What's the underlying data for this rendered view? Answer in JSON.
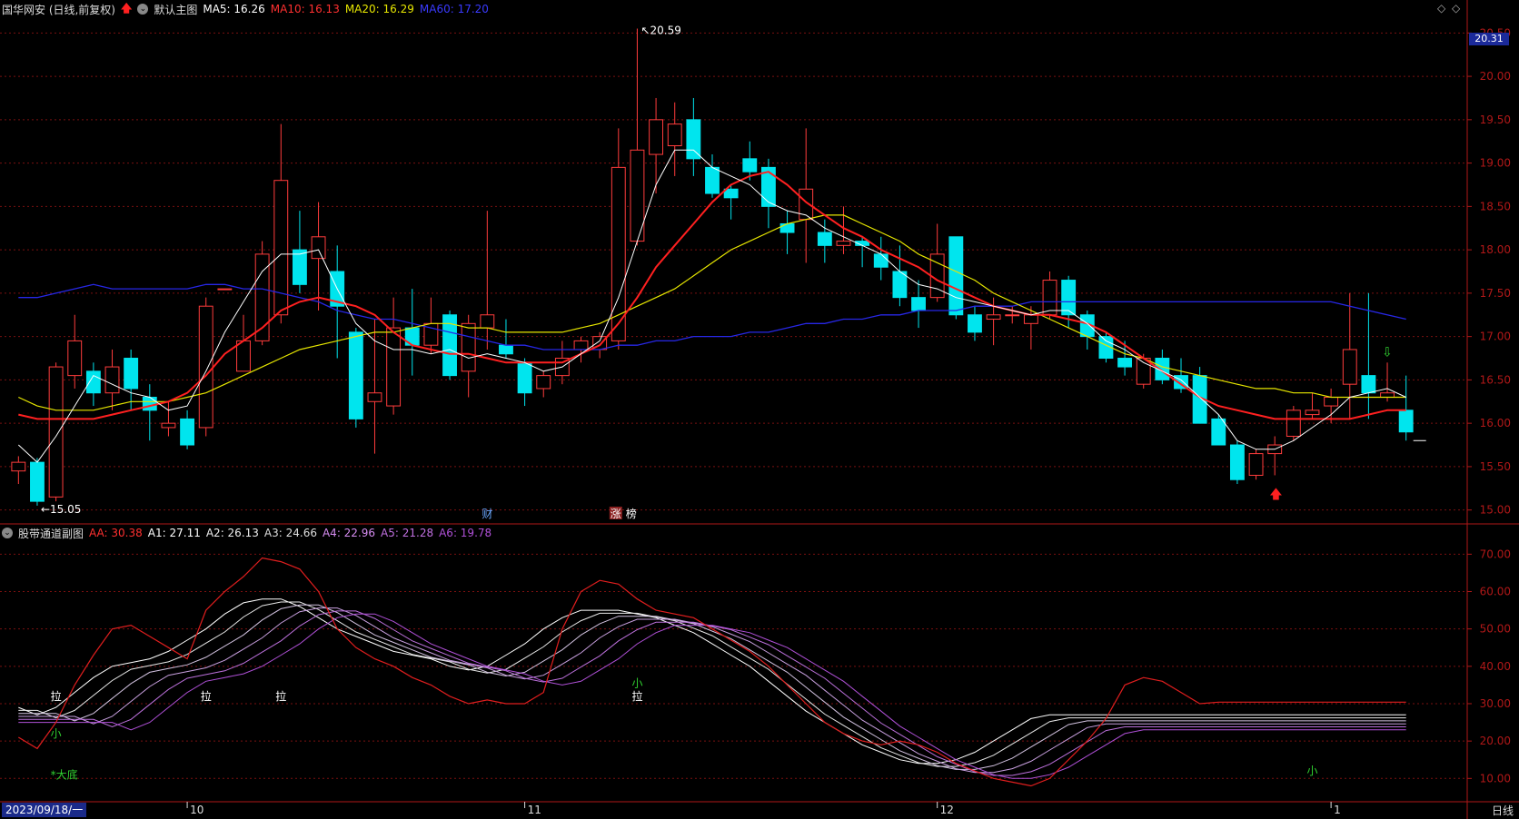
{
  "main_header": {
    "stock": "国华网安 (日线,前复权)",
    "chart_label": "默认主图",
    "ma5": "MA5: 16.26",
    "ma10": "MA10: 16.13",
    "ma20": "MA20: 16.29",
    "ma60": "MA60: 17.20"
  },
  "sub_header": {
    "indicator": "股带通道副图",
    "aa": "AA: 30.38",
    "a1": "A1: 27.11",
    "a2": "A2: 26.13",
    "a3": "A3: 24.66",
    "a4": "A4: 22.96",
    "a5": "A5: 21.28",
    "a6": "A6: 19.78"
  },
  "colors": {
    "bg": "#000000",
    "up": "#ff3c3c",
    "down": "#00e5ee",
    "ma5": "#ffffff",
    "ma10": "#ff2020",
    "ma20": "#e6e600",
    "ma60": "#2727e6",
    "grid": "#7a1010",
    "axis": "#b01818",
    "band_light": "#ffffff",
    "band_dark": "#b43cd2"
  },
  "price_axis": {
    "ticks": [
      "20.50",
      "20.00",
      "19.50",
      "19.00",
      "18.50",
      "18.00",
      "17.50",
      "17.00",
      "16.50",
      "16.00",
      "15.50",
      "15.00"
    ],
    "current": "20.31"
  },
  "sub_axis": {
    "ticks": [
      "70.00",
      "60.00",
      "50.00",
      "40.00",
      "30.00",
      "20.00",
      "10.00"
    ]
  },
  "time_axis": {
    "start": "2023/09/18/一",
    "months": [
      "10",
      "11",
      "12",
      "1"
    ],
    "period": "日线"
  },
  "annotations": {
    "high": "20.59",
    "low": "15.05",
    "event1": "财",
    "event2": "涨",
    "event3": "榜",
    "la": "拉",
    "xiao": "小",
    "dadi": "*大底"
  },
  "chart_data": {
    "type": "candlestick",
    "ohlc": [
      [
        15.45,
        15.55,
        15.3,
        15.62
      ],
      [
        15.55,
        15.1,
        15.05,
        15.6
      ],
      [
        15.15,
        16.65,
        15.1,
        16.7
      ],
      [
        16.55,
        16.95,
        16.4,
        17.25
      ],
      [
        16.6,
        16.35,
        16.2,
        16.7
      ],
      [
        16.35,
        16.65,
        16.15,
        16.85
      ],
      [
        16.75,
        16.4,
        16.15,
        16.85
      ],
      [
        16.3,
        16.15,
        15.8,
        16.45
      ],
      [
        15.95,
        16.0,
        15.85,
        16.25
      ],
      [
        16.05,
        15.75,
        15.7,
        16.15
      ],
      [
        15.95,
        17.35,
        15.85,
        17.45
      ],
      [
        17.55,
        17.55,
        17.55,
        17.55
      ],
      [
        16.6,
        16.95,
        16.6,
        17.25
      ],
      [
        16.95,
        17.95,
        16.9,
        18.1
      ],
      [
        17.25,
        18.8,
        17.15,
        19.45
      ],
      [
        18.0,
        17.6,
        17.5,
        18.45
      ],
      [
        17.9,
        18.15,
        17.3,
        18.55
      ],
      [
        17.75,
        17.35,
        16.75,
        18.05
      ],
      [
        17.05,
        16.05,
        15.95,
        17.1
      ],
      [
        16.25,
        16.35,
        15.65,
        17.2
      ],
      [
        16.2,
        17.1,
        16.1,
        17.45
      ],
      [
        17.1,
        16.9,
        16.55,
        17.55
      ],
      [
        16.9,
        17.15,
        16.8,
        17.45
      ],
      [
        17.25,
        16.55,
        16.5,
        17.3
      ],
      [
        16.6,
        17.15,
        16.3,
        17.25
      ],
      [
        17.1,
        17.25,
        16.85,
        18.45
      ],
      [
        16.9,
        16.8,
        16.75,
        17.2
      ],
      [
        16.7,
        16.35,
        16.2,
        16.75
      ],
      [
        16.4,
        16.55,
        16.3,
        16.6
      ],
      [
        16.55,
        16.75,
        16.45,
        16.95
      ],
      [
        16.85,
        16.95,
        16.7,
        17.0
      ],
      [
        16.85,
        17.0,
        16.75,
        17.05
      ],
      [
        16.95,
        18.95,
        16.85,
        19.4
      ],
      [
        18.1,
        19.15,
        18.05,
        20.55
      ],
      [
        19.1,
        19.5,
        18.65,
        19.75
      ],
      [
        19.2,
        19.45,
        18.85,
        19.7
      ],
      [
        19.5,
        19.05,
        18.85,
        19.75
      ],
      [
        18.95,
        18.65,
        18.6,
        19.1
      ],
      [
        18.7,
        18.6,
        18.35,
        18.75
      ],
      [
        19.05,
        18.9,
        18.8,
        19.25
      ],
      [
        18.95,
        18.5,
        18.25,
        19.05
      ],
      [
        18.3,
        18.2,
        17.95,
        18.45
      ],
      [
        18.35,
        18.7,
        17.85,
        19.4
      ],
      [
        18.2,
        18.05,
        17.85,
        18.35
      ],
      [
        18.05,
        18.1,
        17.95,
        18.5
      ],
      [
        18.1,
        18.05,
        17.8,
        18.15
      ],
      [
        17.95,
        17.8,
        17.65,
        18.15
      ],
      [
        17.75,
        17.45,
        17.35,
        18.05
      ],
      [
        17.45,
        17.3,
        17.1,
        17.65
      ],
      [
        17.45,
        17.95,
        17.4,
        18.3
      ],
      [
        18.15,
        17.25,
        17.2,
        18.15
      ],
      [
        17.25,
        17.05,
        16.95,
        17.35
      ],
      [
        17.2,
        17.25,
        16.9,
        17.45
      ],
      [
        17.25,
        17.25,
        17.15,
        17.35
      ],
      [
        17.15,
        17.25,
        16.85,
        17.35
      ],
      [
        17.25,
        17.65,
        17.2,
        17.75
      ],
      [
        17.65,
        17.25,
        17.1,
        17.7
      ],
      [
        17.25,
        17.0,
        16.85,
        17.3
      ],
      [
        17.0,
        16.75,
        16.7,
        17.05
      ],
      [
        16.75,
        16.65,
        16.55,
        16.95
      ],
      [
        16.45,
        16.75,
        16.4,
        16.8
      ],
      [
        16.75,
        16.5,
        16.45,
        16.85
      ],
      [
        16.55,
        16.4,
        16.35,
        16.75
      ],
      [
        16.55,
        16.0,
        16.0,
        16.65
      ],
      [
        16.05,
        15.75,
        15.75,
        16.1
      ],
      [
        15.75,
        15.35,
        15.3,
        15.8
      ],
      [
        15.4,
        15.65,
        15.35,
        15.7
      ],
      [
        15.65,
        15.75,
        15.4,
        15.85
      ],
      [
        15.85,
        16.15,
        15.8,
        16.2
      ],
      [
        16.1,
        16.15,
        16.05,
        16.35
      ],
      [
        16.2,
        16.3,
        16.0,
        16.4
      ],
      [
        16.45,
        16.85,
        16.05,
        17.5
      ],
      [
        16.55,
        16.35,
        16.05,
        17.5
      ],
      [
        16.3,
        16.35,
        16.25,
        16.7
      ],
      [
        16.15,
        15.9,
        15.8,
        16.55
      ]
    ],
    "ma5": [
      15.75,
      15.55,
      15.85,
      16.2,
      16.55,
      16.45,
      16.35,
      16.3,
      16.15,
      16.2,
      16.6,
      17.05,
      17.4,
      17.75,
      17.95,
      17.95,
      18.0,
      17.55,
      17.15,
      16.95,
      16.85,
      16.85,
      16.8,
      16.85,
      16.75,
      16.8,
      16.75,
      16.7,
      16.6,
      16.65,
      16.8,
      16.95,
      17.45,
      18.1,
      18.75,
      19.15,
      19.15,
      18.95,
      18.85,
      18.75,
      18.55,
      18.45,
      18.4,
      18.25,
      18.15,
      18.05,
      17.95,
      17.75,
      17.6,
      17.55,
      17.45,
      17.4,
      17.35,
      17.3,
      17.25,
      17.3,
      17.3,
      17.15,
      16.95,
      16.85,
      16.7,
      16.6,
      16.5,
      16.3,
      16.1,
      15.8,
      15.7,
      15.7,
      15.8,
      15.95,
      16.1,
      16.3,
      16.35,
      16.4,
      16.3
    ],
    "ma10": [
      16.1,
      16.05,
      16.05,
      16.05,
      16.05,
      16.1,
      16.15,
      16.2,
      16.25,
      16.35,
      16.55,
      16.8,
      16.95,
      17.1,
      17.3,
      17.4,
      17.45,
      17.4,
      17.35,
      17.25,
      17.05,
      16.9,
      16.85,
      16.8,
      16.8,
      16.75,
      16.7,
      16.7,
      16.7,
      16.7,
      16.8,
      16.9,
      17.15,
      17.45,
      17.8,
      18.05,
      18.3,
      18.55,
      18.75,
      18.85,
      18.9,
      18.75,
      18.55,
      18.4,
      18.25,
      18.15,
      18.0,
      17.9,
      17.8,
      17.65,
      17.55,
      17.45,
      17.35,
      17.3,
      17.25,
      17.25,
      17.2,
      17.15,
      17.05,
      16.9,
      16.75,
      16.6,
      16.45,
      16.3,
      16.2,
      16.15,
      16.1,
      16.05,
      16.05,
      16.05,
      16.05,
      16.05,
      16.1,
      16.15,
      16.15
    ],
    "ma20": [
      16.3,
      16.2,
      16.15,
      16.15,
      16.15,
      16.2,
      16.25,
      16.25,
      16.25,
      16.3,
      16.35,
      16.45,
      16.55,
      16.65,
      16.75,
      16.85,
      16.9,
      16.95,
      17.0,
      17.05,
      17.05,
      17.1,
      17.15,
      17.15,
      17.1,
      17.1,
      17.05,
      17.05,
      17.05,
      17.05,
      17.1,
      17.15,
      17.25,
      17.35,
      17.45,
      17.55,
      17.7,
      17.85,
      18.0,
      18.1,
      18.2,
      18.3,
      18.35,
      18.4,
      18.4,
      18.3,
      18.2,
      18.1,
      17.95,
      17.85,
      17.75,
      17.65,
      17.5,
      17.4,
      17.3,
      17.2,
      17.1,
      17.0,
      16.9,
      16.8,
      16.75,
      16.65,
      16.6,
      16.55,
      16.5,
      16.45,
      16.4,
      16.4,
      16.35,
      16.35,
      16.3,
      16.3,
      16.3,
      16.3,
      16.3
    ],
    "ma60": [
      17.45,
      17.45,
      17.5,
      17.55,
      17.6,
      17.55,
      17.55,
      17.55,
      17.55,
      17.55,
      17.6,
      17.6,
      17.55,
      17.55,
      17.5,
      17.45,
      17.4,
      17.3,
      17.25,
      17.2,
      17.2,
      17.15,
      17.1,
      17.05,
      17.0,
      16.95,
      16.9,
      16.9,
      16.85,
      16.85,
      16.85,
      16.85,
      16.9,
      16.9,
      16.95,
      16.95,
      17.0,
      17.0,
      17.0,
      17.05,
      17.05,
      17.1,
      17.15,
      17.15,
      17.2,
      17.2,
      17.25,
      17.25,
      17.3,
      17.3,
      17.3,
      17.35,
      17.35,
      17.35,
      17.4,
      17.4,
      17.4,
      17.4,
      17.4,
      17.4,
      17.4,
      17.4,
      17.4,
      17.4,
      17.4,
      17.4,
      17.4,
      17.4,
      17.4,
      17.4,
      17.4,
      17.35,
      17.3,
      17.25,
      17.2
    ],
    "sub_aa": [
      21.0,
      18.0,
      25.0,
      35.0,
      43.0,
      50.0,
      51.0,
      48.0,
      45.0,
      42.0,
      55.0,
      60.0,
      64.0,
      69.0,
      68.0,
      66.0,
      60.0,
      50.0,
      45.0,
      42.0,
      40.0,
      37.0,
      35.0,
      32.0,
      30.0,
      31.0,
      30.0,
      30.0,
      33.0,
      50.0,
      60.0,
      63.0,
      62.0,
      58.0,
      55.0,
      54.0,
      53.0,
      50.0,
      47.0,
      44.0,
      40.0,
      35.0,
      30.0,
      25.0,
      22.0,
      20.0,
      19.0,
      20.0,
      19.0,
      17.0,
      14.0,
      12.0,
      10.0,
      9.0,
      8.0,
      10.0,
      15.0,
      20.0,
      26.0,
      35.0,
      37.0,
      36.0,
      33.0,
      30.0,
      30.4,
      30.4,
      30.4,
      30.4,
      30.4,
      30.4,
      30.4,
      30.4,
      30.4,
      30.4,
      30.4
    ],
    "sub_a1": [
      29,
      27,
      29,
      33,
      37,
      40,
      41,
      42,
      44,
      47,
      50,
      54,
      57,
      58,
      58,
      56,
      53,
      50,
      48,
      46,
      44,
      43,
      42,
      40,
      39,
      40,
      43,
      46,
      50,
      53,
      55,
      55,
      55,
      54,
      53,
      51,
      49,
      46,
      43,
      40,
      36,
      32,
      28,
      25,
      22,
      19,
      17,
      15,
      14,
      14,
      15,
      17,
      20,
      23,
      26,
      27,
      27,
      27,
      27,
      27,
      27,
      27,
      27,
      27,
      27,
      27,
      27,
      27,
      27,
      27,
      27,
      27,
      27,
      27,
      27
    ]
  }
}
